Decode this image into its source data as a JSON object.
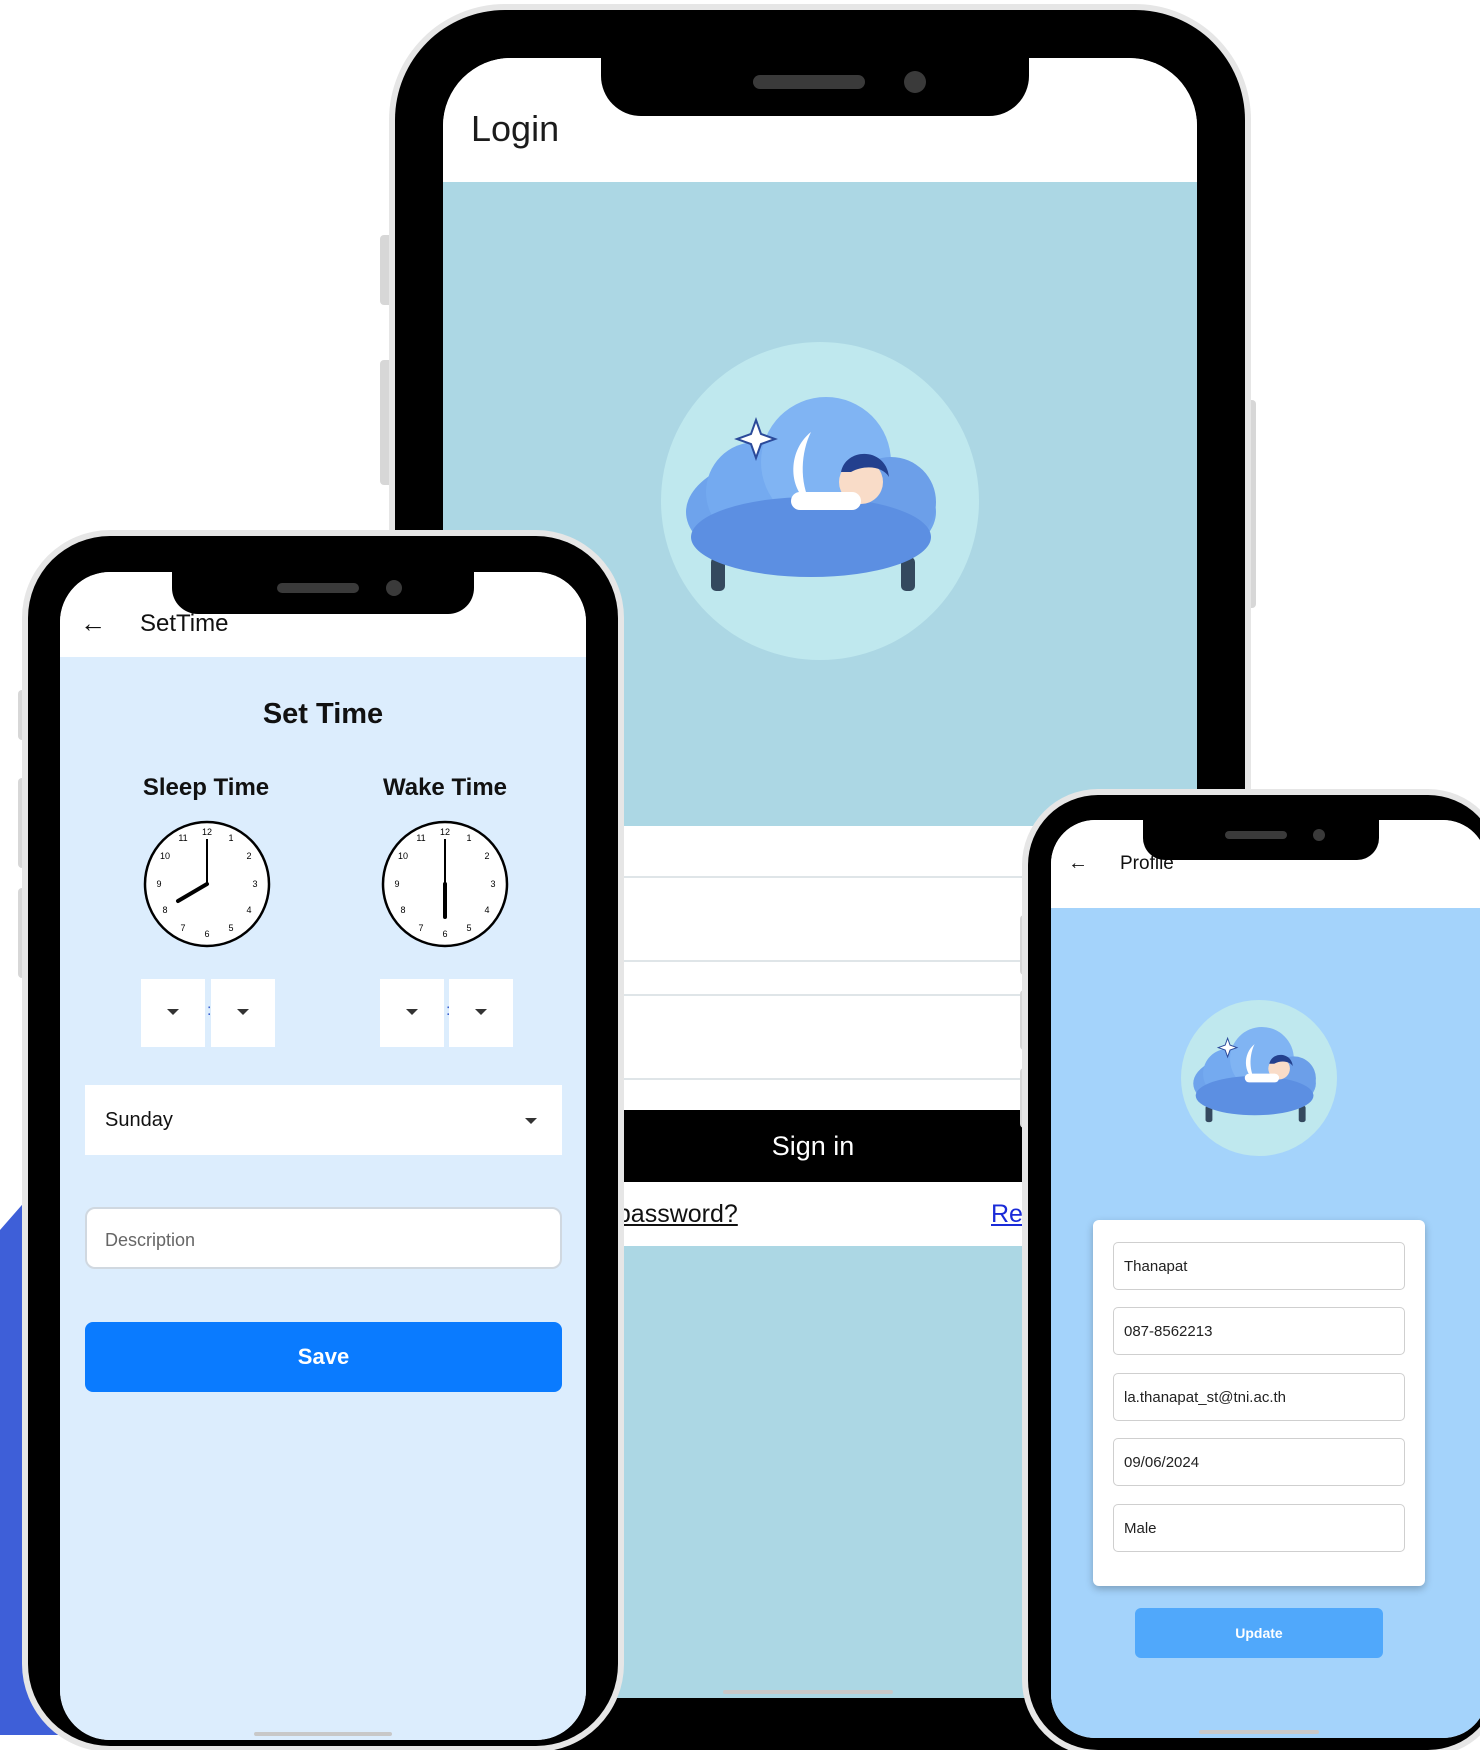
{
  "login_screen": {
    "title": "Login",
    "sign_in_label": "Sign in",
    "forgot_password_visible": "t password?",
    "register_visible": "Re"
  },
  "settime_screen": {
    "app_bar_title": "SetTime",
    "heading": "Set Time",
    "sleep_label": "Sleep Time",
    "wake_label": "Wake Time",
    "sleep_clock": {
      "hour_hand_points_to": 8,
      "minute_hand_points_to": 12
    },
    "wake_clock": {
      "hour_hand_points_to": 6,
      "minute_hand_points_to": 12
    },
    "clock_numbers": [
      "12",
      "1",
      "2",
      "3",
      "4",
      "5",
      "6",
      "7",
      "8",
      "9",
      "10",
      "11"
    ],
    "time_separator": ":",
    "day_value": "Sunday",
    "description_placeholder": "Description",
    "save_label": "Save"
  },
  "profile_screen": {
    "app_bar_title": "Profile",
    "fields": [
      "Thanapat",
      "087-8562213",
      "la.thanapat_st@tni.ac.th",
      "09/06/2024",
      "Male"
    ],
    "update_label": "Update"
  },
  "colors": {
    "accent_blue": "#3e5fd8",
    "login_background": "#acd7e4",
    "settime_background": "#dcedfd",
    "profile_background": "#a4d3fb",
    "save_button": "#0a7bff",
    "update_button": "#50a8fb"
  }
}
